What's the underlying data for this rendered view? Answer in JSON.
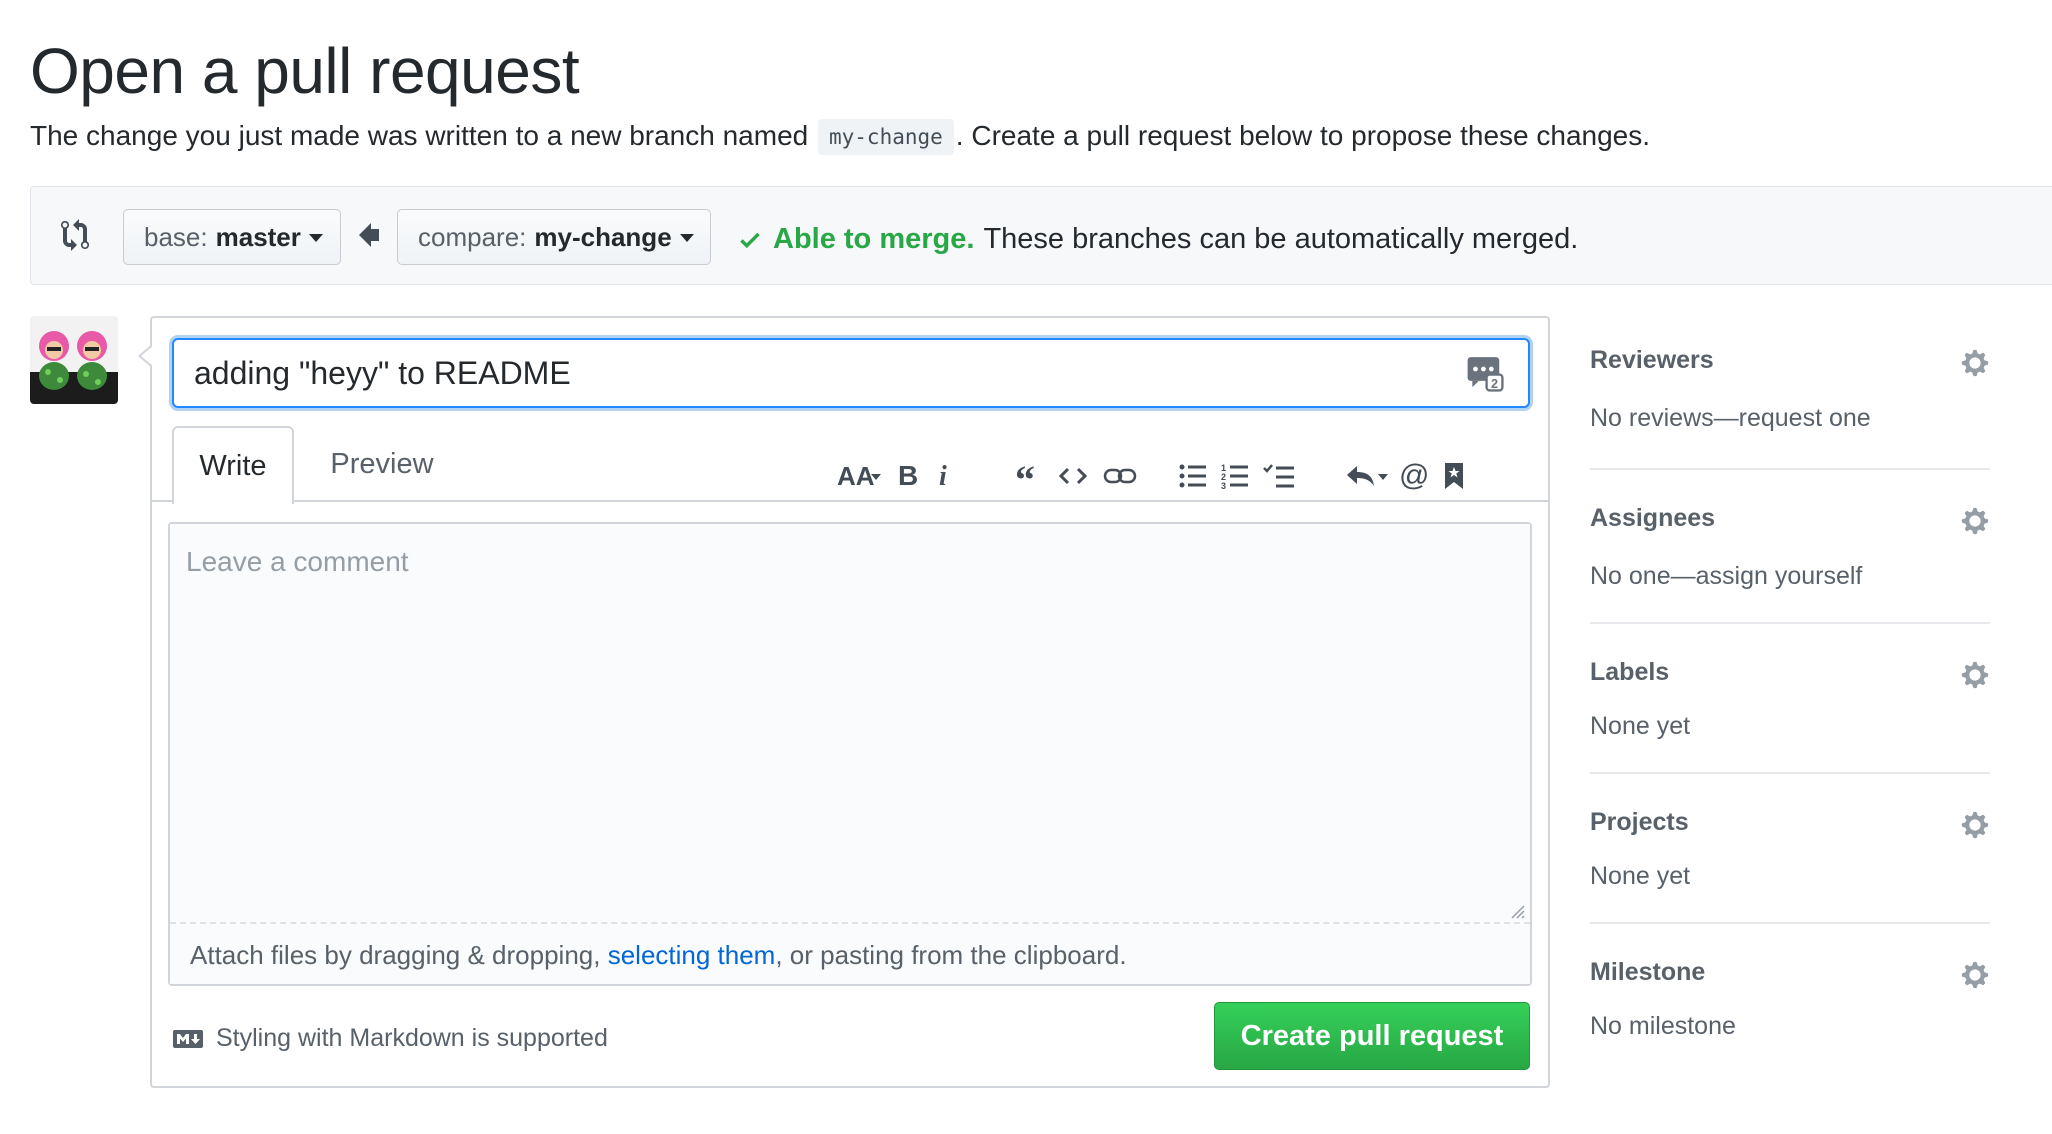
{
  "page": {
    "title": "Open a pull request",
    "intro_before": "The change you just made was written to a new branch named",
    "branch_name": "my-change",
    "intro_after": ". Create a pull request below to propose these changes."
  },
  "compare": {
    "base_label": "base:",
    "base_branch": "master",
    "compare_label": "compare:",
    "compare_branch": "my-change",
    "merge_status": "Able to merge.",
    "merge_detail": "These branches can be automatically merged."
  },
  "form": {
    "title_value": "adding \"heyy\" to README",
    "tabs": {
      "write": "Write",
      "preview": "Preview"
    },
    "comment_placeholder": "Leave a comment",
    "attach_text_1": "Attach files by dragging & dropping, ",
    "attach_link": "selecting them",
    "attach_text_2": ", or pasting from the clipboard.",
    "markdown_hint": "Styling with Markdown is supported",
    "submit_label": "Create pull request",
    "toolbar_icons": [
      "header-icon",
      "bold-icon",
      "italic-icon",
      "quote-icon",
      "code-icon",
      "link-icon",
      "unordered-list-icon",
      "ordered-list-icon",
      "task-list-icon",
      "reply-icon",
      "mention-icon",
      "reference-icon"
    ]
  },
  "sidebar": {
    "items": [
      {
        "title": "Reviewers",
        "value": "No reviews—request one"
      },
      {
        "title": "Assignees",
        "value": "No one—assign yourself"
      },
      {
        "title": "Labels",
        "value": "None yet"
      },
      {
        "title": "Projects",
        "value": "None yet"
      },
      {
        "title": "Milestone",
        "value": "No milestone"
      }
    ]
  },
  "colors": {
    "success": "#28a745",
    "link": "#0366d6",
    "focus": "#2188ff",
    "text_muted": "#586069"
  }
}
